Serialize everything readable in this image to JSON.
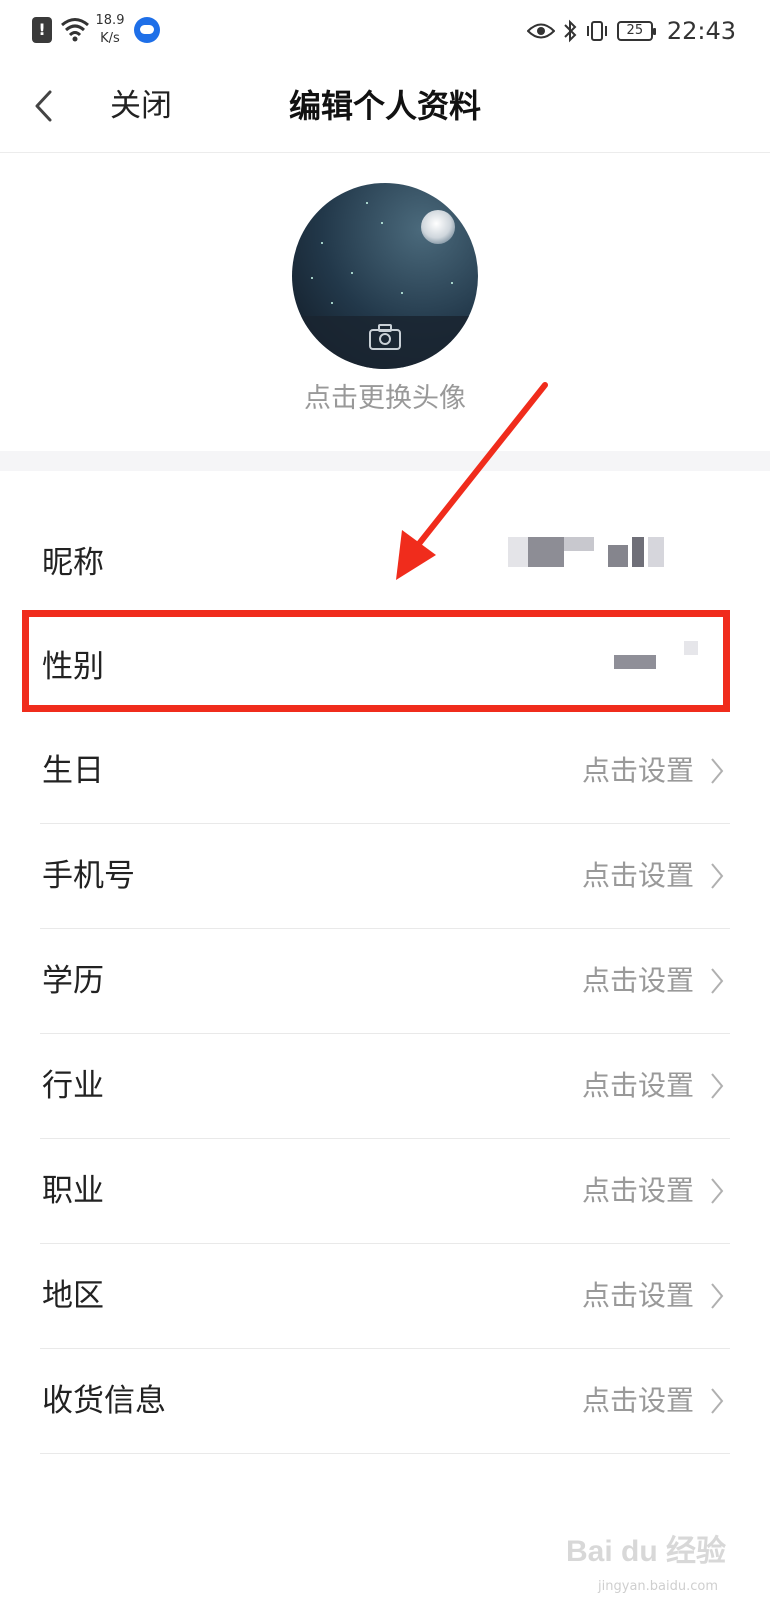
{
  "status_bar": {
    "alert": "!",
    "speed_value": "18.9",
    "speed_unit": "K/s",
    "battery": "25",
    "time": "22:43"
  },
  "header": {
    "back_icon": "chevron-left-icon",
    "close_label": "关闭",
    "title": "编辑个人资料"
  },
  "avatar": {
    "hint": "点击更换头像",
    "overlay_icon": "camera-icon"
  },
  "list": {
    "nickname": {
      "label": "昵称"
    },
    "gender": {
      "label": "性别"
    },
    "birthday": {
      "label": "生日",
      "value": "点击设置"
    },
    "phone": {
      "label": "手机号",
      "value": "点击设置"
    },
    "education": {
      "label": "学历",
      "value": "点击设置"
    },
    "industry": {
      "label": "行业",
      "value": "点击设置"
    },
    "occupation": {
      "label": "职业",
      "value": "点击设置"
    },
    "region": {
      "label": "地区",
      "value": "点击设置"
    },
    "shipping": {
      "label": "收货信息",
      "value": "点击设置"
    }
  },
  "annotation": {
    "highlight_color": "#f02c1c"
  },
  "watermark": {
    "brand": "Bai du 经验",
    "site": "jingyan.baidu.com"
  }
}
